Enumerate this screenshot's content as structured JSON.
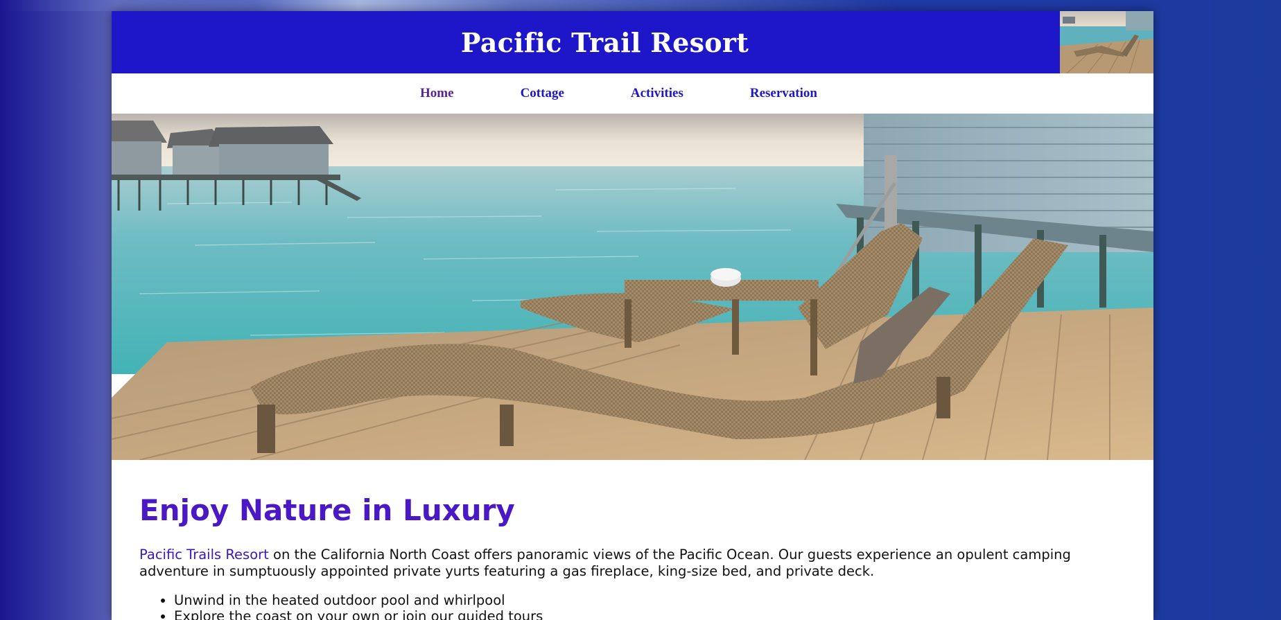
{
  "site": {
    "title": "Pacific Trail Resort"
  },
  "nav": {
    "items": [
      {
        "label": "Home"
      },
      {
        "label": "Cottage"
      },
      {
        "label": "Activities"
      },
      {
        "label": "Reservation"
      }
    ]
  },
  "colors": {
    "header_bg": "#1e16c9",
    "heading": "#4a18c4",
    "link": "#1e16c9",
    "visited_link": "#5a2490"
  },
  "main": {
    "heading": "Enjoy Nature in Luxury",
    "intro_brand": "Pacific Trails Resort",
    "intro_text": " on the California North Coast offers panoramic views of the Pacific Ocean. Our guests experience an opulent camping adventure in sumptuously appointed private yurts featuring a gas fireplace, king-size bed, and private deck.",
    "features": [
      "Unwind in the heated outdoor pool and whirlpool",
      "Explore the coast on your own or join our guided tours"
    ]
  }
}
